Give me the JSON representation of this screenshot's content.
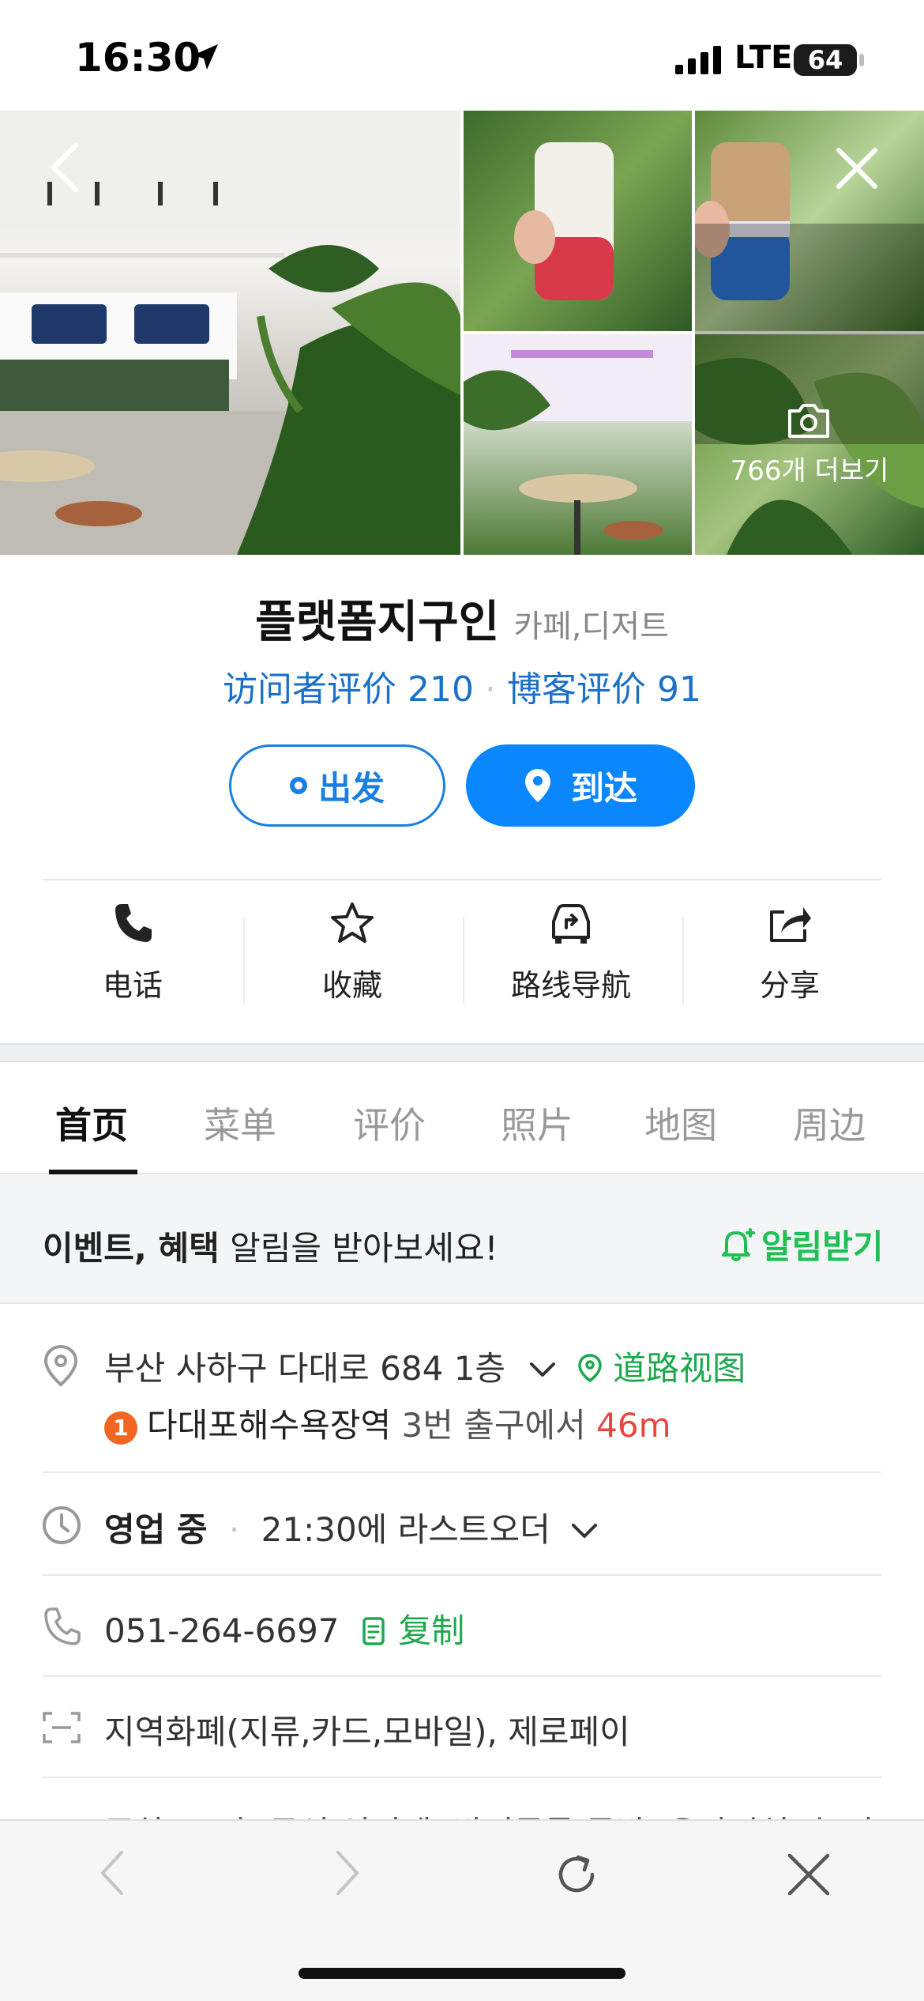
{
  "status_bar": {
    "time": "16:30",
    "network": "LTE",
    "battery": "64"
  },
  "gallery": {
    "more_label": "766개 더보기"
  },
  "place": {
    "name": "플랫폼지구인",
    "category": "카페,디저트",
    "visitor_reviews": "访问者评价 210",
    "blog_reviews": "博客评价 91"
  },
  "route_buttons": {
    "depart": "出发",
    "arrive": "到达"
  },
  "actions": [
    {
      "label": "电话",
      "icon": "phone-icon"
    },
    {
      "label": "收藏",
      "icon": "star-icon"
    },
    {
      "label": "路线导航",
      "icon": "navigation-car-icon"
    },
    {
      "label": "分享",
      "icon": "share-icon"
    }
  ],
  "tabs": [
    {
      "label": "首页",
      "active": true
    },
    {
      "label": "菜单"
    },
    {
      "label": "评价"
    },
    {
      "label": "照片"
    },
    {
      "label": "地图"
    },
    {
      "label": "周边"
    }
  ],
  "notice": {
    "bold_text": "이벤트, 혜택",
    "text": " 알림을 받아보세요!",
    "button": "알림받기"
  },
  "info": {
    "address": "부산 사하구 다대로 684 1층",
    "street_view": "道路视图",
    "subway_line": "1",
    "subway_station": "다대포해수욕장역",
    "subway_exit": "3번 출구에서",
    "subway_distance": "46m",
    "hours_status": "영업 중",
    "hours_detail": "21:30에 라스트오더",
    "phone": "051-264-6697",
    "copy_label": "复制",
    "payment": "지역화폐(지류,카드,모바일), 제로페이",
    "partial_row": "주차, 포장, 무선 인터넷, 반려동물 동반, 유아시설 (놀이"
  },
  "colors": {
    "accent_blue": "#0a86ff",
    "link_blue": "#1a6fc8",
    "green": "#1ea84e",
    "red": "#e8483b",
    "line_badge": "#f26522"
  }
}
